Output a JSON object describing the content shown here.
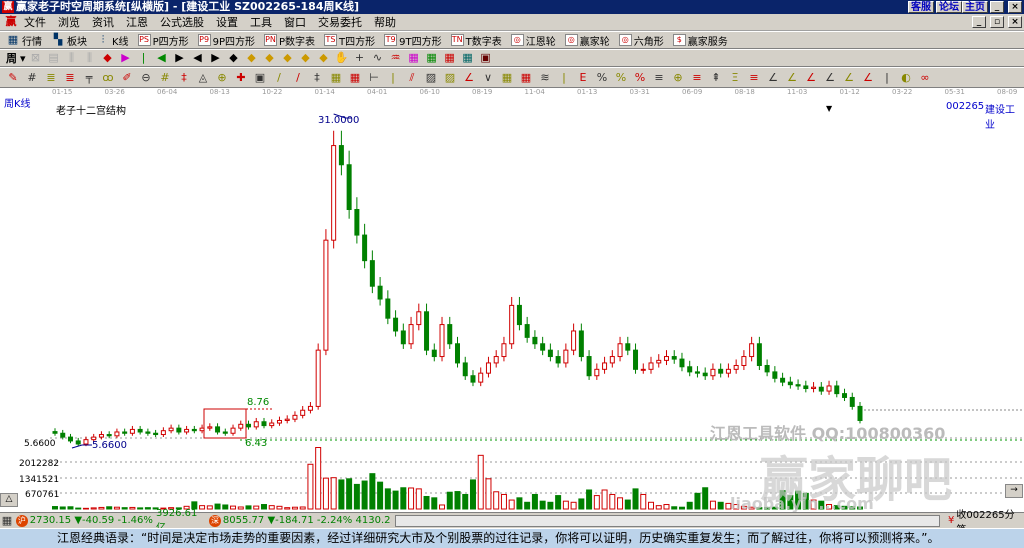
{
  "titlebar": {
    "title": "赢家老子时空周期系统[纵横版] - [建设工业   SZ002265-184周K线]",
    "links": [
      "客服",
      "论坛",
      "主页"
    ],
    "logo": "赢"
  },
  "menu": [
    "文件",
    "浏览",
    "资讯",
    "江恩",
    "公式选股",
    "设置",
    "工具",
    "窗口",
    "交易委托",
    "帮助"
  ],
  "toolbar1": [
    {
      "icon": "PS",
      "label": "P四方形"
    },
    {
      "icon": "P9",
      "label": "9P四方形"
    },
    {
      "icon": "PN",
      "label": "P数字表"
    },
    {
      "icon": "TS",
      "label": "T四方形"
    },
    {
      "icon": "T9",
      "label": "9T四方形"
    },
    {
      "icon": "TN",
      "label": "T数字表"
    },
    {
      "icon": "◎",
      "label": "江恩轮"
    },
    {
      "icon": "◎",
      "label": "赢家轮"
    },
    {
      "icon": "◎",
      "label": "六角形"
    },
    {
      "icon": "$",
      "label": "赢家服务"
    }
  ],
  "toolbar1_lead": [
    {
      "icon": "▦",
      "label": "行情"
    },
    {
      "icon": "▚",
      "label": "板块"
    },
    {
      "icon": "⫶",
      "label": "K线"
    }
  ],
  "period_selector": "周",
  "chart": {
    "period_label": "周K线",
    "indicator_name": "老子十二宫结构",
    "stock_code": "002265",
    "stock_name": "建设工业",
    "high_label": "31.0000",
    "low_label": "5.6600",
    "axis_low": "5.6600",
    "box_high": "8.76",
    "box_low": "6.43",
    "vol_ticks": [
      "2012282",
      "1341521",
      "670761"
    ],
    "watermark1": "江恩工具软件  QQ:100800360",
    "watermark2": "赢家聊吧",
    "watermark3": "liaoba.yin...com"
  },
  "dates": [
    "01-15",
    "03-26",
    "06-04",
    "08-13",
    "10-22",
    "01-14",
    "04-01",
    "06-10",
    "08-19",
    "11-04",
    "01-13",
    "03-31",
    "06-09",
    "08-18",
    "11-03",
    "01-12",
    "03-22",
    "05-31",
    "08-09"
  ],
  "status": {
    "sh_index": "2730.15",
    "sh_change": "▼-40.59",
    "sh_pct": "-1.46%",
    "sh_amount": "3926.61亿",
    "sz_index": "8055.77",
    "sz_change": "▼-184.71",
    "sz_pct": "-2.24%",
    "sz_amount": "4130.2",
    "receive": "收002265分笔",
    "sh_badge": "沪",
    "sz_badge": "深"
  },
  "quote": "江恩经典语录：“时间是决定市场走势的重要因素，经过详细研究大市及个别股票的过往记录，你将可以证明，历史确实重复发生；而了解过往，你将可以预测将来。”。",
  "colors": {
    "up": "#d00000",
    "down": "#008000",
    "title": "#0a246a"
  },
  "chart_data": {
    "type": "candlestick",
    "ylim": [
      5.66,
      31
    ],
    "close": [
      6.5,
      6.2,
      5.9,
      5.66,
      6.0,
      6.2,
      6.4,
      6.3,
      6.6,
      6.5,
      6.8,
      6.6,
      6.5,
      6.4,
      6.7,
      6.9,
      6.6,
      6.8,
      6.7,
      6.9,
      7.0,
      6.6,
      6.5,
      6.9,
      7.2,
      7.0,
      7.4,
      7.1,
      7.3,
      7.5,
      7.6,
      7.9,
      8.3,
      8.6,
      13.0,
      21.6,
      29.0,
      27.5,
      24,
      22,
      20,
      18,
      17,
      15.5,
      14.5,
      13.5,
      15,
      16,
      13,
      12.5,
      15,
      13.5,
      12,
      11,
      10.5,
      11.2,
      12,
      12.5,
      13.5,
      16.5,
      15,
      14,
      13.5,
      13,
      12.5,
      12,
      13,
      14.5,
      12.5,
      11,
      11.5,
      12,
      12.5,
      13.5,
      13,
      11.5,
      11.5,
      12,
      12.2,
      12.5,
      12.3,
      11.7,
      11.3,
      11.2,
      11,
      11.5,
      11.2,
      11.5,
      11.8,
      12.5,
      13.5,
      11.8,
      11.3,
      10.8,
      10.5,
      10.3,
      10.2,
      10,
      10.1,
      9.8,
      10.2,
      9.6,
      9.3,
      8.6,
      7.5
    ],
    "volume": [
      110000,
      90000,
      100000,
      40000,
      30000,
      50000,
      70000,
      100000,
      80000,
      60000,
      70000,
      50000,
      60000,
      50000,
      40000,
      60000,
      50000,
      120000,
      320000,
      150000,
      140000,
      220000,
      180000,
      130000,
      90000,
      140000,
      130000,
      200000,
      150000,
      120000,
      60000,
      80000,
      90000,
      2000000,
      2750000,
      1380000,
      1400000,
      1300000,
      1350000,
      1100000,
      1250000,
      1580000,
      1200000,
      900000,
      800000,
      950000,
      940000,
      900000,
      560000,
      500000,
      180000,
      750000,
      780000,
      650000,
      1300000,
      2400000,
      1350000,
      770000,
      650000,
      400000,
      500000,
      300000,
      650000,
      350000,
      300000,
      600000,
      350000,
      300000,
      450000,
      850000,
      600000,
      850000,
      650000,
      500000,
      400000,
      900000,
      650000,
      300000,
      150000,
      200000,
      100000,
      80000,
      300000,
      700000,
      950000,
      350000,
      300000,
      250000,
      200000,
      120000,
      80000,
      60000,
      70000,
      80000,
      820000,
      600000,
      800000,
      700000,
      400000,
      350000,
      200000,
      150000,
      120000,
      100000,
      90000
    ]
  }
}
